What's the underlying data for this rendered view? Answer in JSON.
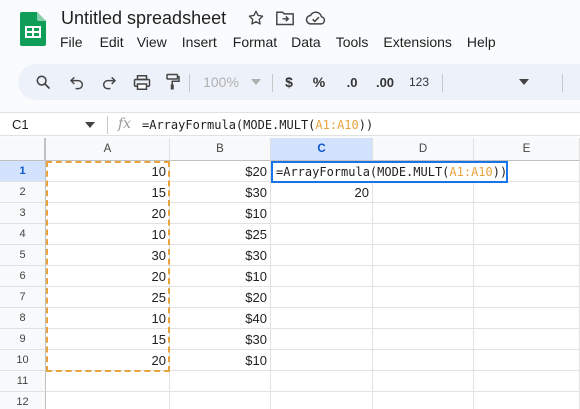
{
  "title": "Untitled spreadsheet",
  "menu": [
    "File",
    "Edit",
    "View",
    "Insert",
    "Format",
    "Data",
    "Tools",
    "Extensions",
    "Help"
  ],
  "toolbar": {
    "zoom": "100%",
    "currency": "$",
    "percent": "%",
    "decrease_decimal": ".0",
    "increase_decimal": ".00",
    "number_format": "123"
  },
  "name_box": "C1",
  "formula_bar": {
    "fx": "fx",
    "prefix": "=ArrayFormula(MODE.MULT(",
    "range": "A1:A10",
    "suffix": "))"
  },
  "columns": [
    "A",
    "B",
    "C",
    "D",
    "E"
  ],
  "rows": [
    "1",
    "2",
    "3",
    "4",
    "5",
    "6",
    "7",
    "8",
    "9",
    "10",
    "11",
    "12"
  ],
  "cells": {
    "A": [
      "10",
      "15",
      "20",
      "10",
      "30",
      "20",
      "25",
      "10",
      "15",
      "20",
      "",
      ""
    ],
    "B": [
      "$20",
      "$30",
      "$10",
      "$25",
      "$30",
      "$10",
      "$20",
      "$40",
      "$30",
      "$10",
      "",
      ""
    ],
    "C": [
      "",
      "20",
      "",
      "",
      "",
      "",
      "",
      "",
      "",
      "",
      "",
      ""
    ]
  },
  "active_cell": "C1",
  "accent_color": "#1a73e8",
  "reference_color": "#e8a33d"
}
